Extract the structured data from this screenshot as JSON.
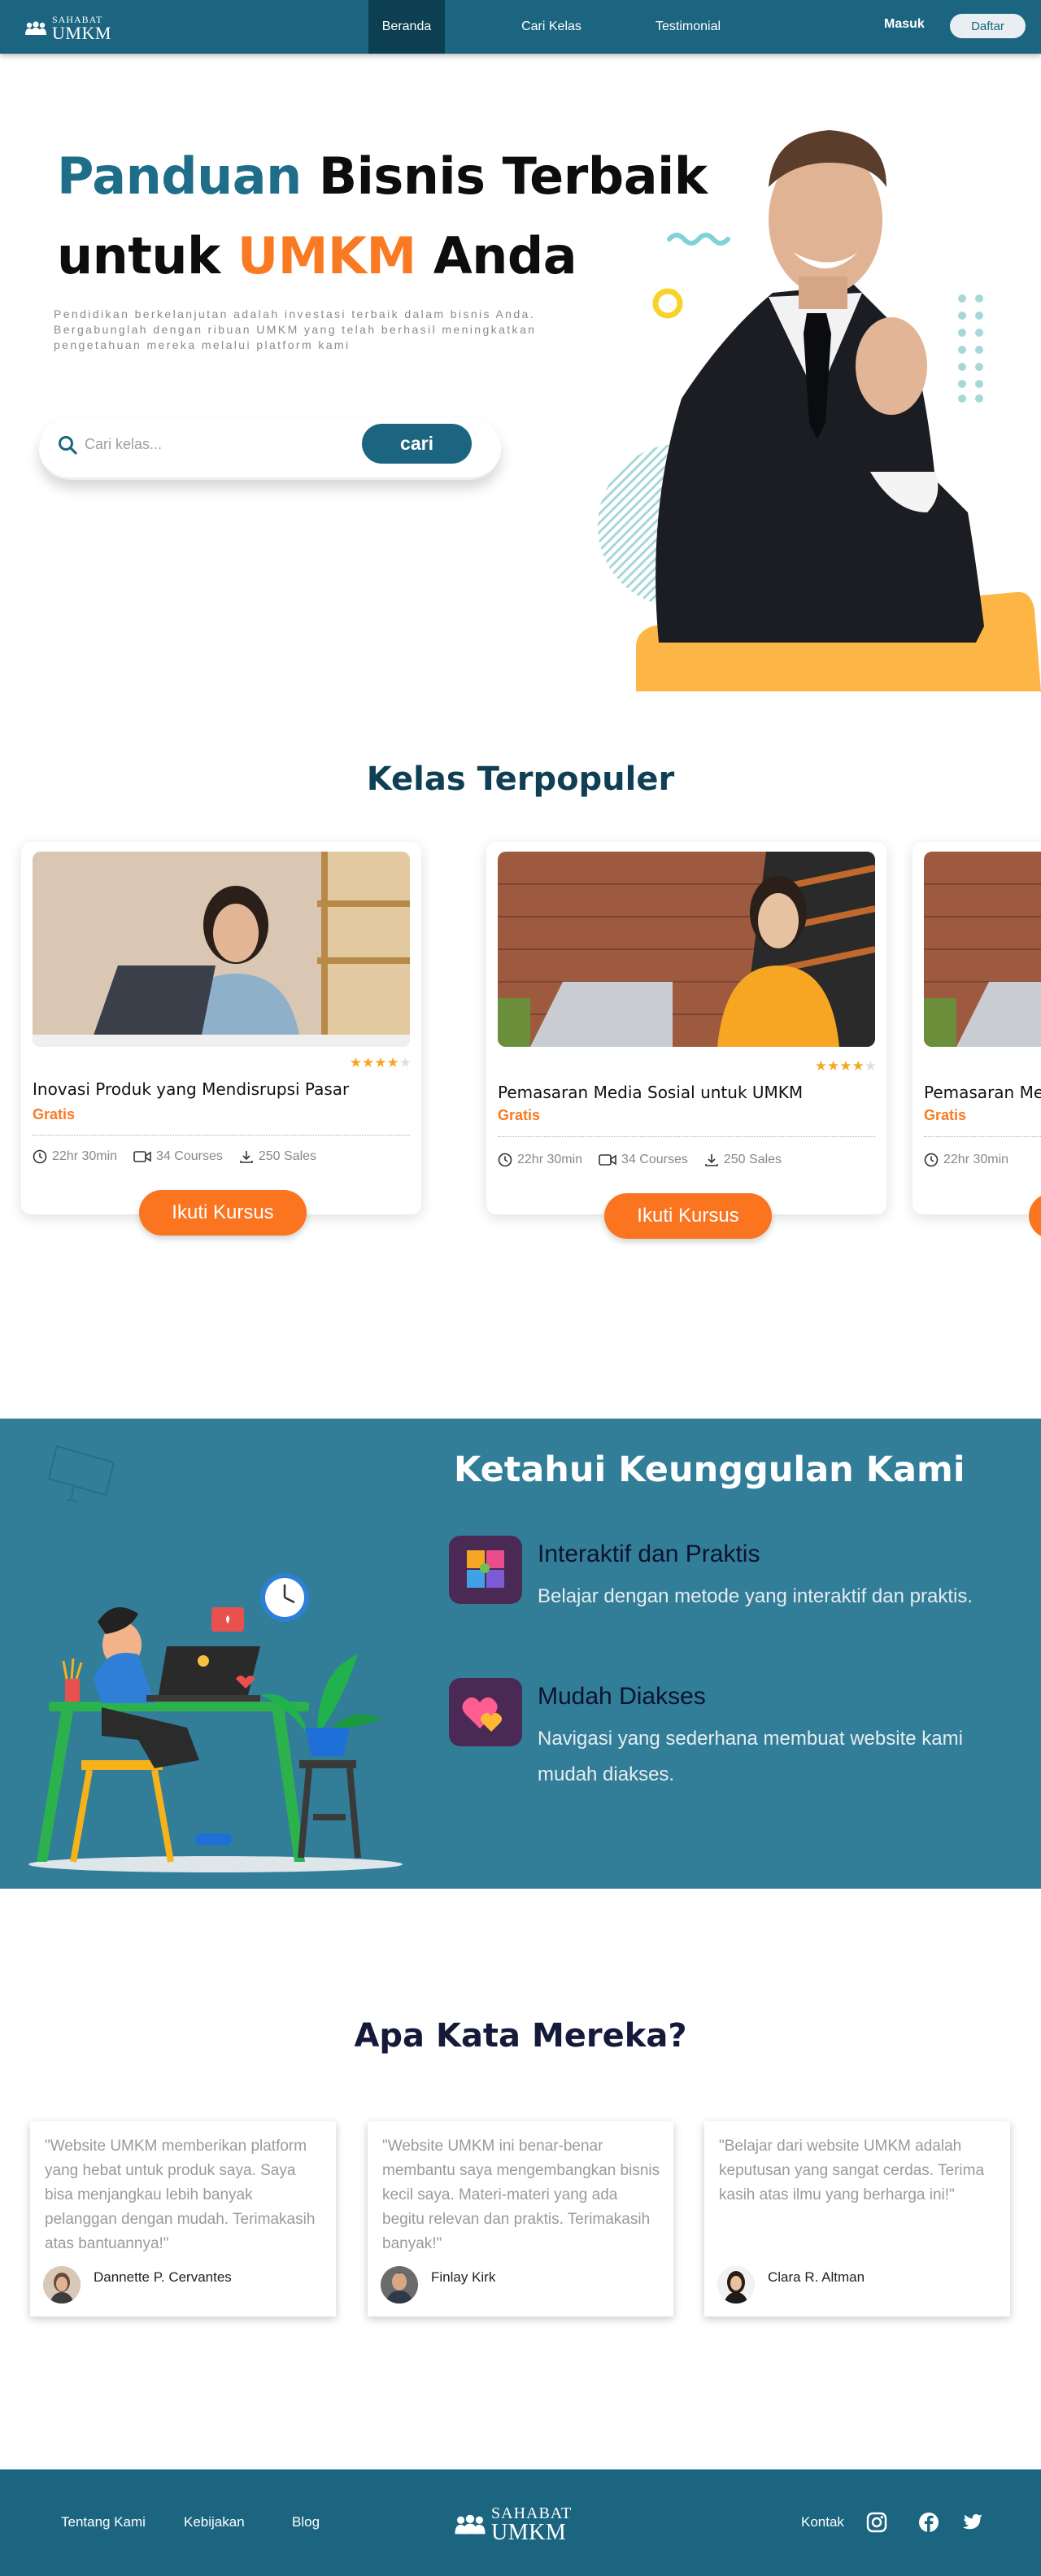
{
  "nav": {
    "logo_top": "SAHABAT",
    "logo_bottom": "UMKM",
    "links": [
      "Beranda",
      "Cari Kelas",
      "Testimonial"
    ],
    "login": "Masuk",
    "register": "Daftar"
  },
  "hero": {
    "title_l1_a": "Panduan",
    "title_l1_b": " Bisnis Terbaik",
    "title_l2_a": "untuk ",
    "title_l2_b": "UMKM",
    "title_l2_c": " Anda",
    "description": "Pendidikan berkelanjutan adalah investasi terbaik dalam bisnis Anda. Bergabunglah dengan ribuan UMKM yang telah berhasil meningkatkan pengetahuan mereka melalui platform kami",
    "search_placeholder": "Cari kelas...",
    "search_button": "cari"
  },
  "courses": {
    "title": "Kelas Terpopuler",
    "rating": 4,
    "items": [
      {
        "name": "Inovasi Produk yang Mendisrupsi Pasar",
        "price": "Gratis",
        "duration": "22hr 30min",
        "courses": "34 Courses",
        "sales": "250 Sales",
        "button": "Ikuti Kursus"
      },
      {
        "name": "Pemasaran Media Sosial untuk UMKM",
        "price": "Gratis",
        "duration": "22hr 30min",
        "courses": "34 Courses",
        "sales": "250 Sales",
        "button": "Ikuti Kursus"
      },
      {
        "name": "Pemasaran Me",
        "price": "Gratis",
        "duration": "22hr 30min"
      }
    ]
  },
  "features": {
    "title": "Ketahui Keunggulan Kami",
    "items": [
      {
        "name": "Interaktif dan Praktis",
        "desc": "Belajar dengan metode yang interaktif dan praktis."
      },
      {
        "name": "Mudah Diakses",
        "desc": "Navigasi yang sederhana membuat website kami mudah diakses."
      }
    ]
  },
  "testimonials": {
    "title": "Apa Kata Mereka?",
    "items": [
      {
        "quote": "\"Website UMKM memberikan platform yang hebat untuk produk saya. Saya bisa menjangkau lebih banyak pelanggan dengan mudah. Terimakasih atas bantuannya!\"",
        "name": "Dannette P. Cervantes"
      },
      {
        "quote": "\"Website UMKM ini benar-benar membantu saya mengembangkan bisnis kecil saya. Materi-materi yang ada begitu relevan dan praktis. Terimakasih banyak!\"",
        "name": "Finlay Kirk"
      },
      {
        "quote": "\"Belajar dari website UMKM adalah keputusan yang sangat cerdas. Terima kasih atas ilmu yang berharga ini!\"",
        "name": "Clara R. Altman"
      }
    ]
  },
  "footer": {
    "links": [
      "Tentang Kami",
      "Kebijakan",
      "Blog"
    ],
    "logo_top": "SAHABAT",
    "logo_bottom": "UMKM",
    "contact": "Kontak",
    "social_icons": [
      "instagram-icon",
      "facebook-icon",
      "twitter-icon"
    ]
  },
  "colors": {
    "primary": "#1c6580",
    "accent": "#f97a22",
    "feature_bg": "#327e98",
    "star": "#f5a623"
  }
}
